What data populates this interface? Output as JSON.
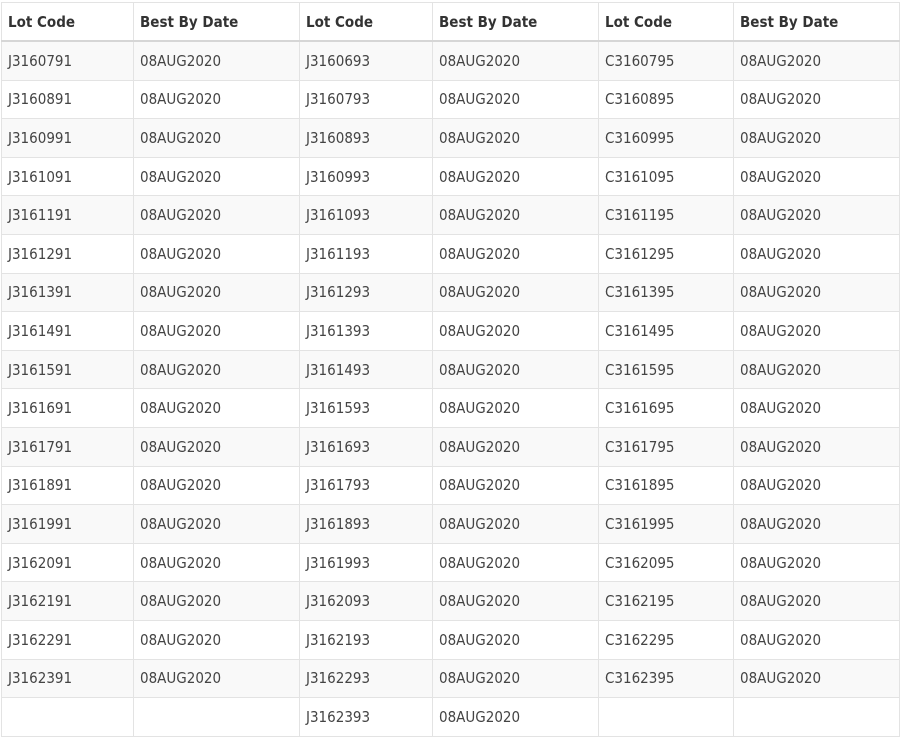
{
  "table": {
    "headers": [
      "Lot Code",
      "Best By Date",
      "Lot Code",
      "Best By Date",
      "Lot Code",
      "Best By Date"
    ],
    "rows": [
      [
        "J3160791",
        "08AUG2020",
        "J3160693",
        "08AUG2020",
        "C3160795",
        "08AUG2020"
      ],
      [
        "J3160891",
        "08AUG2020",
        "J3160793",
        "08AUG2020",
        "C3160895",
        "08AUG2020"
      ],
      [
        "J3160991",
        "08AUG2020",
        "J3160893",
        "08AUG2020",
        "C3160995",
        "08AUG2020"
      ],
      [
        "J3161091",
        "08AUG2020",
        "J3160993",
        "08AUG2020",
        "C3161095",
        "08AUG2020"
      ],
      [
        "J3161191",
        "08AUG2020",
        "J3161093",
        "08AUG2020",
        "C3161195",
        "08AUG2020"
      ],
      [
        "J3161291",
        "08AUG2020",
        "J3161193",
        "08AUG2020",
        "C3161295",
        "08AUG2020"
      ],
      [
        "J3161391",
        "08AUG2020",
        "J3161293",
        "08AUG2020",
        "C3161395",
        "08AUG2020"
      ],
      [
        "J3161491",
        "08AUG2020",
        "J3161393",
        "08AUG2020",
        "C3161495",
        "08AUG2020"
      ],
      [
        "J3161591",
        "08AUG2020",
        "J3161493",
        "08AUG2020",
        "C3161595",
        "08AUG2020"
      ],
      [
        "J3161691",
        "08AUG2020",
        "J3161593",
        "08AUG2020",
        "C3161695",
        "08AUG2020"
      ],
      [
        "J3161791",
        "08AUG2020",
        "J3161693",
        "08AUG2020",
        "C3161795",
        "08AUG2020"
      ],
      [
        "J3161891",
        "08AUG2020",
        "J3161793",
        "08AUG2020",
        "C3161895",
        "08AUG2020"
      ],
      [
        "J3161991",
        "08AUG2020",
        "J3161893",
        "08AUG2020",
        "C3161995",
        "08AUG2020"
      ],
      [
        "J3162091",
        "08AUG2020",
        "J3161993",
        "08AUG2020",
        "C3162095",
        "08AUG2020"
      ],
      [
        "J3162191",
        "08AUG2020",
        "J3162093",
        "08AUG2020",
        "C3162195",
        "08AUG2020"
      ],
      [
        "J3162291",
        "08AUG2020",
        "J3162193",
        "08AUG2020",
        "C3162295",
        "08AUG2020"
      ],
      [
        "J3162391",
        "08AUG2020",
        "J3162293",
        "08AUG2020",
        "C3162395",
        "08AUG2020"
      ],
      [
        "",
        "",
        "J3162393",
        "08AUG2020",
        "",
        ""
      ]
    ]
  }
}
